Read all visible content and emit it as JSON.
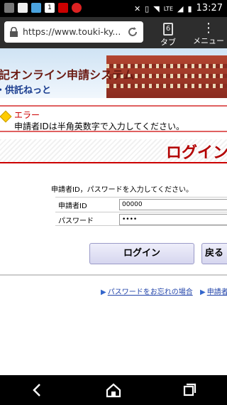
{
  "status_bar": {
    "time": "13:27",
    "icons": [
      "notification-icon",
      "mail-icon",
      "alert-icon",
      "calendar-icon",
      "tool-icon",
      "app-icon",
      "mute-icon",
      "vibrate-icon",
      "wifi-icon",
      "lte-icon",
      "signal-icon",
      "battery-icon"
    ],
    "calendar_day": "1"
  },
  "browser": {
    "url": "https://www.touki-ky...",
    "tabs_count": "6",
    "tabs_label": "タブ",
    "menu_label": "メニュー"
  },
  "banner": {
    "title": "記オンライン申請システム",
    "subtitle": "・供託ねっと"
  },
  "error": {
    "title": "エラー",
    "message": "申請者IDは半角英数字で入力してください。"
  },
  "login": {
    "heading": "ログイン",
    "instruction": "申請者ID，パスワードを入力してください。",
    "id_label": "申請者ID",
    "id_value": "00000",
    "password_label": "パスワード",
    "password_value": "••••",
    "login_button": "ログイン",
    "back_button": "戻る"
  },
  "links": {
    "forgot_password": "パスワードをお忘れの場合",
    "second": "申請者"
  },
  "colors": {
    "accent_red": "#cc0000",
    "link_blue": "#2244aa",
    "button_face": "#d6d6ef"
  }
}
